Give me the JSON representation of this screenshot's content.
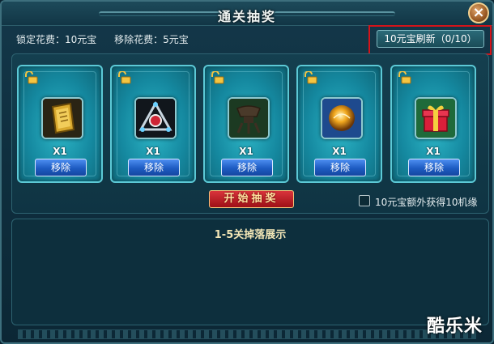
{
  "window": {
    "title": "通关抽奖",
    "close_label": "×"
  },
  "costs": {
    "lock_cost": "锁定花费：10元宝",
    "remove_cost": "移除花费：5元宝"
  },
  "refresh": {
    "label": "10元宝刷新（0/10）"
  },
  "cards": [
    {
      "item": "golden-book-icon",
      "quantity": "X1",
      "remove_label": "移除"
    },
    {
      "item": "jeweled-amulet-icon",
      "quantity": "X1",
      "remove_label": "移除"
    },
    {
      "item": "bronze-vessel-icon",
      "quantity": "X1",
      "remove_label": "移除"
    },
    {
      "item": "glowing-orb-icon",
      "quantity": "X1",
      "remove_label": "移除"
    },
    {
      "item": "gift-box-icon",
      "quantity": "X1",
      "remove_label": "移除"
    }
  ],
  "start_button": {
    "label": "开始抽奖"
  },
  "bonus_option": {
    "label": "10元宝额外获得10机缘",
    "checked": false
  },
  "drops_panel": {
    "title": "1-5关掉落展示"
  },
  "watermark": {
    "text": "酷乐米"
  }
}
